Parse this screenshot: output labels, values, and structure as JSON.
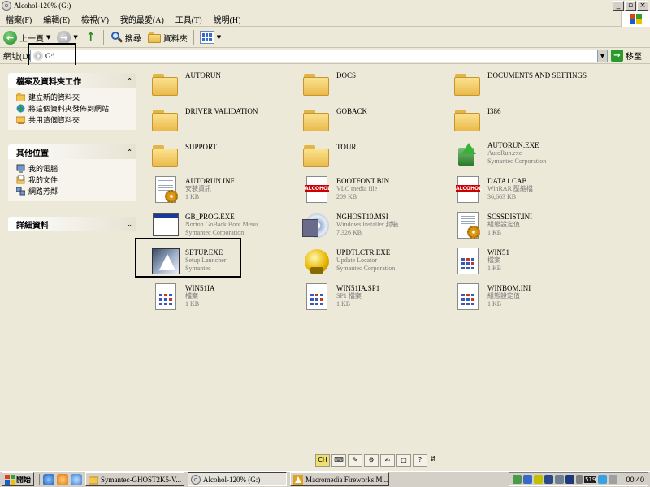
{
  "window": {
    "title": "Alcohol-120% (G:)",
    "controls": [
      "_",
      "▫",
      "×"
    ]
  },
  "menu": [
    "檔案(F)",
    "編輯(E)",
    "檢視(V)",
    "我的最愛(A)",
    "工具(T)",
    "說明(H)"
  ],
  "toolbar": {
    "back_label": "上一頁",
    "search_label": "搜尋",
    "folders_label": "資料夾"
  },
  "address": {
    "label": "網址(D)",
    "value": "G:\\",
    "go_label": "移至"
  },
  "tasks": {
    "title": "檔案及資料夾工作",
    "items": [
      "建立新的資料夾",
      "將這個資料夾發佈到網站",
      "共用這個資料夾"
    ]
  },
  "other_places": {
    "title": "其他位置",
    "items": [
      "我的電腦",
      "我的文件",
      "網路芳鄰"
    ]
  },
  "details": {
    "title": "詳細資料"
  },
  "files": [
    {
      "name": "AUTORUN",
      "type": "",
      "meta": "",
      "icon": "folder-icon"
    },
    {
      "name": "DOCS",
      "type": "",
      "meta": "",
      "icon": "folder-icon"
    },
    {
      "name": "DOCUMENTS AND SETTINGS",
      "type": "",
      "meta": "",
      "icon": "folder-icon"
    },
    {
      "name": "DRIVER VALIDATION",
      "type": "",
      "meta": "",
      "icon": "folder-icon"
    },
    {
      "name": "GOBACK",
      "type": "",
      "meta": "",
      "icon": "folder-icon"
    },
    {
      "name": "I386",
      "type": "",
      "meta": "",
      "icon": "folder-icon"
    },
    {
      "name": "SUPPORT",
      "type": "",
      "meta": "",
      "icon": "folder-icon"
    },
    {
      "name": "TOUR",
      "type": "",
      "meta": "",
      "icon": "folder-icon"
    },
    {
      "name": "AUTORUN.EXE",
      "type": "AutoRun.exe",
      "meta": "Symantec Corporation",
      "icon": "autorun-exe-icon"
    },
    {
      "name": "AUTORUN.INF",
      "type": "安裝資訊",
      "meta": "1 KB",
      "icon": "setup-info-icon"
    },
    {
      "name": "BOOTFONT.BIN",
      "type": "VLC media file",
      "meta": "209 KB",
      "icon": "alcohol-file-icon"
    },
    {
      "name": "DATA1.CAB",
      "type": "WinRAR 壓縮檔",
      "meta": "36,663 KB",
      "icon": "alcohol-file-icon"
    },
    {
      "name": "GB_PROG.EXE",
      "type": "Norton GoBack Boot Menu",
      "meta": "Symantec Corporation",
      "icon": "window-exe-icon"
    },
    {
      "name": "NGHOST10.MSI",
      "type": "Windows Installer 封裝",
      "meta": "7,326 KB",
      "icon": "msi-installer-icon"
    },
    {
      "name": "SCSSDIST.INI",
      "type": "組態設定值",
      "meta": "1 KB",
      "icon": "config-file-icon"
    },
    {
      "name": "SETUP.EXE",
      "type": "Setup Launcher",
      "meta": "Symantec",
      "icon": "setup-launcher-icon"
    },
    {
      "name": "UPDTLCTR.EXE",
      "type": "Update Locator",
      "meta": "Symantec Corporation",
      "icon": "update-locator-icon"
    },
    {
      "name": "WIN51",
      "type": "檔案",
      "meta": "1 KB",
      "icon": "generic-file-icon"
    },
    {
      "name": "WIN51IA",
      "type": "檔案",
      "meta": "1 KB",
      "icon": "generic-file-icon"
    },
    {
      "name": "WIN51IA.SP1",
      "type": "SP1 檔案",
      "meta": "1 KB",
      "icon": "generic-file-icon"
    },
    {
      "name": "WINBOM.INI",
      "type": "組態設定值",
      "meta": "1 KB",
      "icon": "config-file-icon"
    }
  ],
  "language_bar": {
    "ime": "CH",
    "help": "?"
  },
  "taskbar": {
    "start_label": "開始",
    "buttons": [
      "Symantec-GHOST2K5-V...",
      "Alcohol-120% (G:)",
      "Macromedia Fireworks M..."
    ],
    "tray_number": "519",
    "clock": "00:40"
  }
}
